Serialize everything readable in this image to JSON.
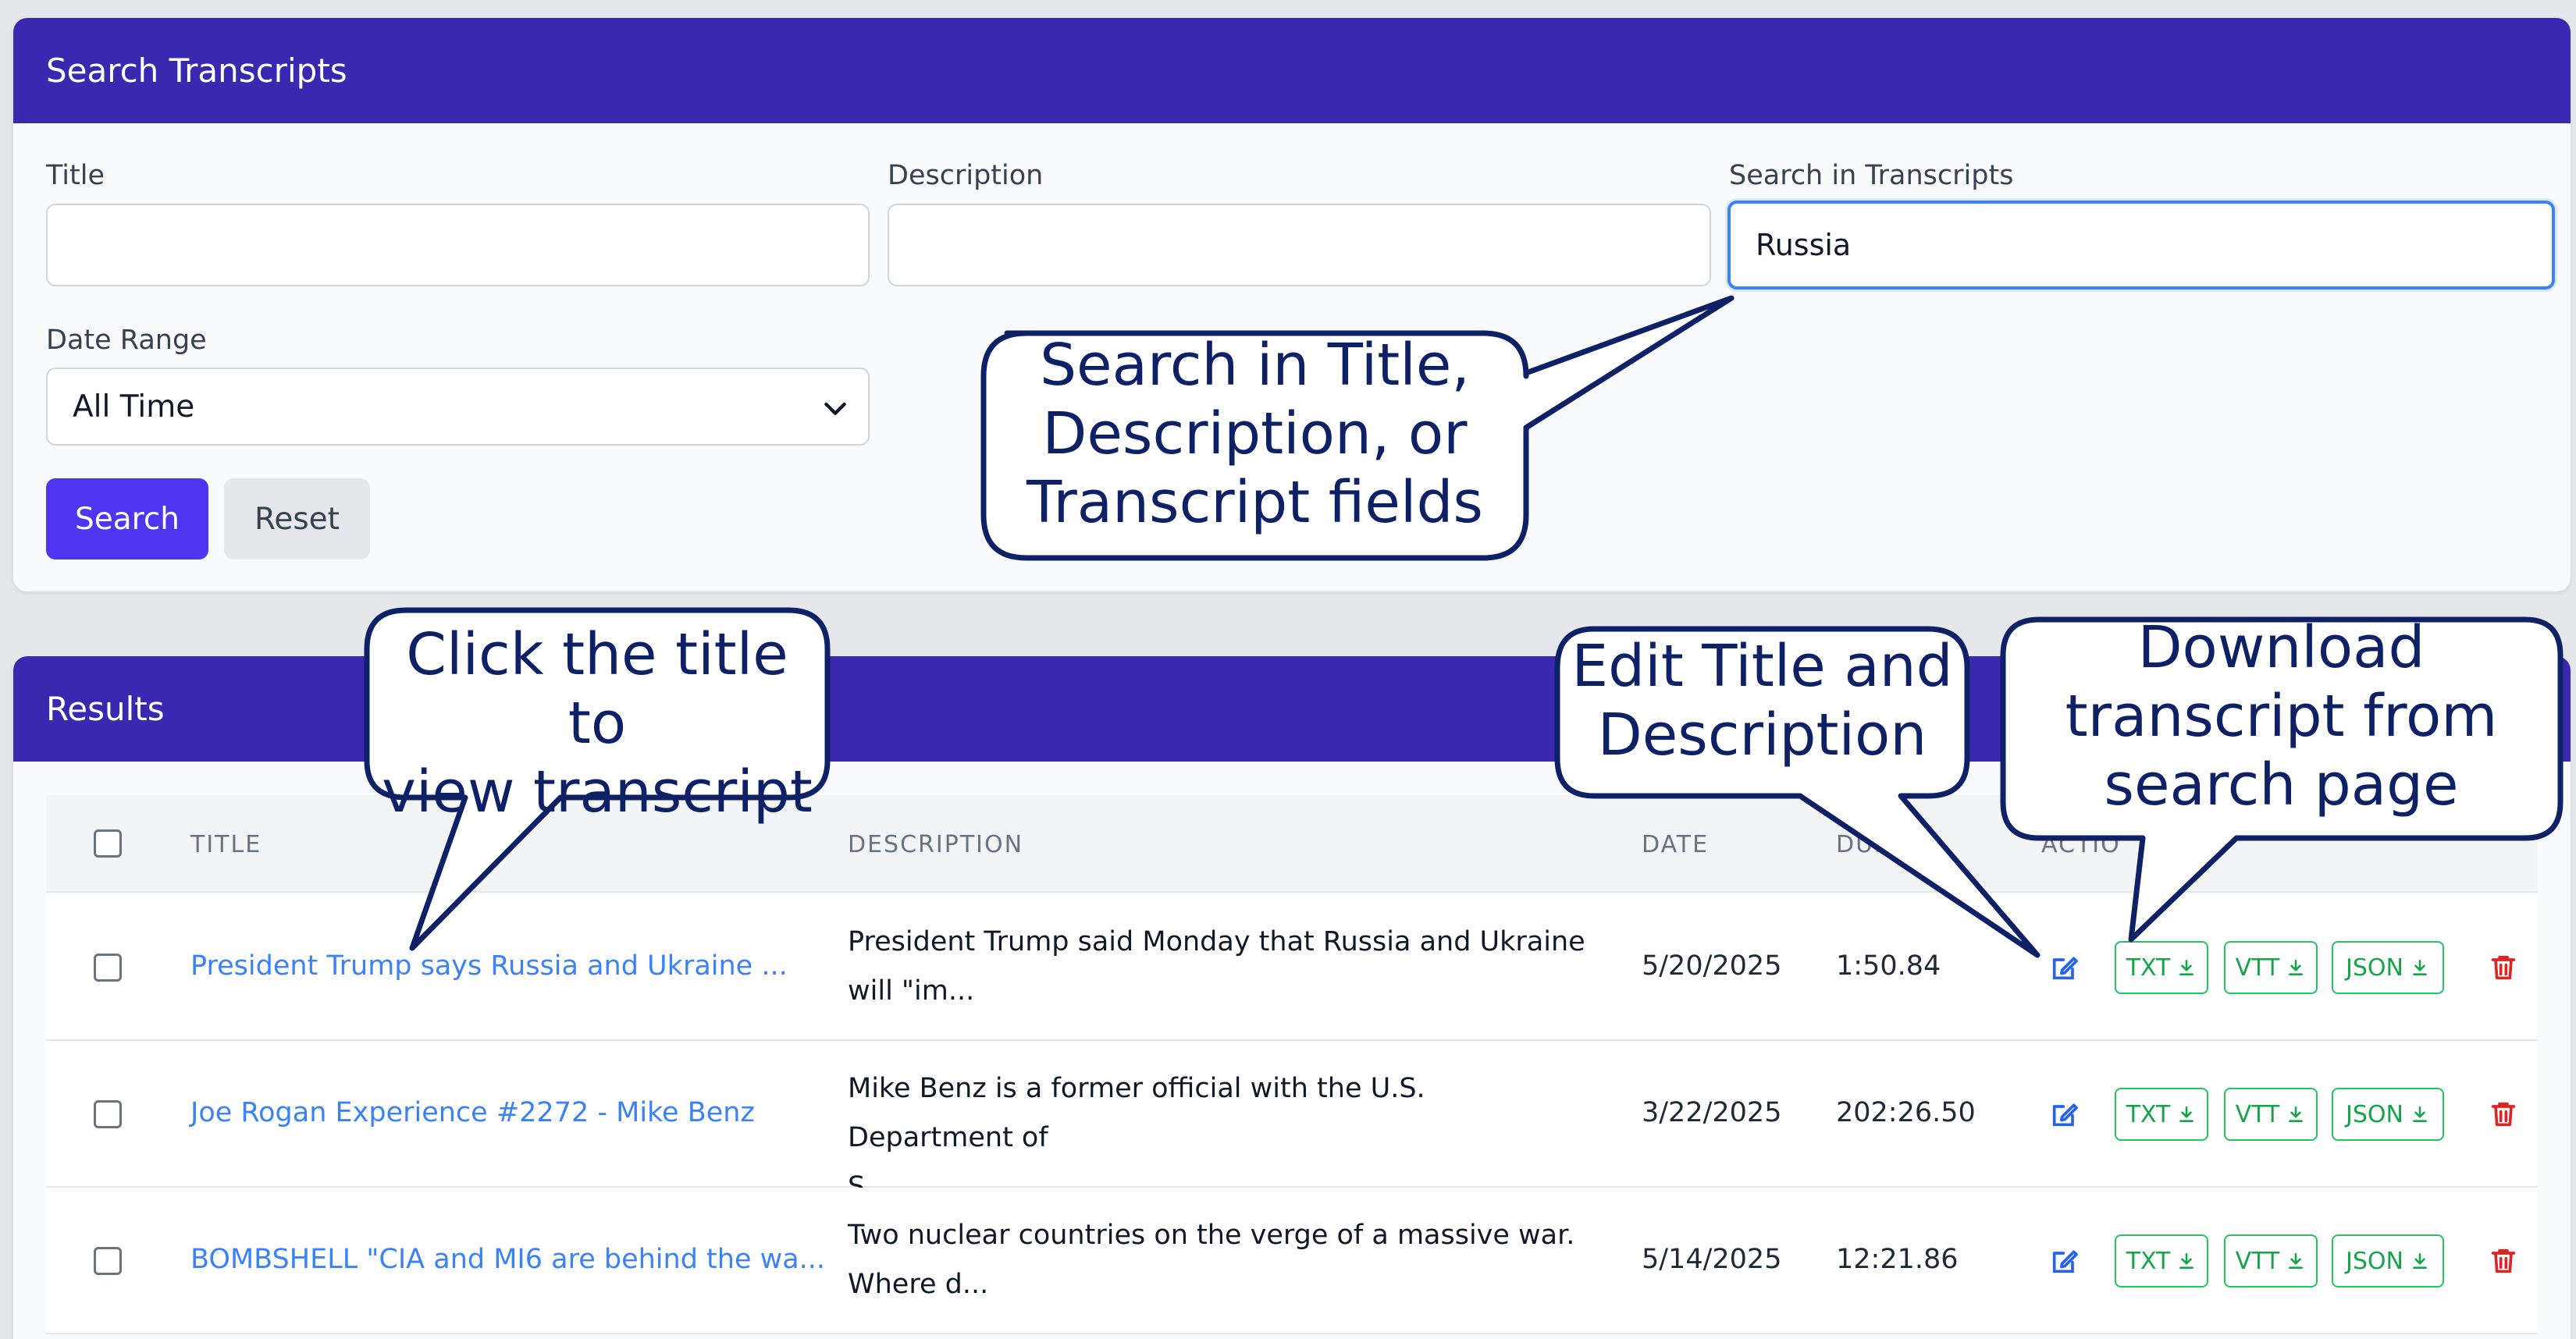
{
  "search": {
    "header": "Search Transcripts",
    "title_label": "Title",
    "title_value": "",
    "description_label": "Description",
    "description_value": "",
    "transcripts_label": "Search in Transcripts",
    "transcripts_value": "Russia",
    "date_range_label": "Date Range",
    "date_range_selected": "All Time",
    "search_button": "Search",
    "reset_button": "Reset"
  },
  "results": {
    "header": "Results",
    "columns": [
      "TITLE",
      "DESCRIPTION",
      "DATE",
      "DURATION",
      "ACTIONS"
    ],
    "visible_column_text": {
      "duration": "DUR",
      "actions": "ACTIO"
    },
    "download_labels": {
      "txt": "TXT",
      "vtt": "VTT",
      "json": "JSON"
    },
    "rows": [
      {
        "title": "President Trump says Russia and Ukraine ...",
        "description_line1": "President Trump said Monday that Russia and Ukraine",
        "description_line2": "will \"im...",
        "date": "5/20/2025",
        "duration": "1:50.84"
      },
      {
        "title": "Joe Rogan Experience #2272 - Mike Benz",
        "description_line1": "Mike Benz is a former official with the U.S. Department of",
        "description_line2": "S...",
        "date": "3/22/2025",
        "duration": "202:26.50"
      },
      {
        "title": "BOMBSHELL \"CIA and MI6 are behind the wa...",
        "description_line1": "Two nuclear countries on the verge of a massive war.",
        "description_line2": "Where d...",
        "date": "5/14/2025",
        "duration": "12:21.86"
      }
    ]
  },
  "callouts": {
    "search_fields": [
      "Search in Title,",
      "Description, or",
      "Transcript fields"
    ],
    "click_title": [
      "Click the title to",
      "view transcript"
    ],
    "edit": [
      "Edit Title and",
      "Description"
    ],
    "download": [
      "Download",
      "transcript from",
      "search page"
    ]
  },
  "colors": {
    "header_bg": "#3a29b0",
    "primary_button": "#4f35f0",
    "link": "#3b82f6",
    "download_green": "#16a34a",
    "delete_red": "#dc2626",
    "callout_border": "#0f2166"
  },
  "icons": [
    "chevron-down-icon",
    "edit-icon",
    "download-icon",
    "trash-icon"
  ]
}
